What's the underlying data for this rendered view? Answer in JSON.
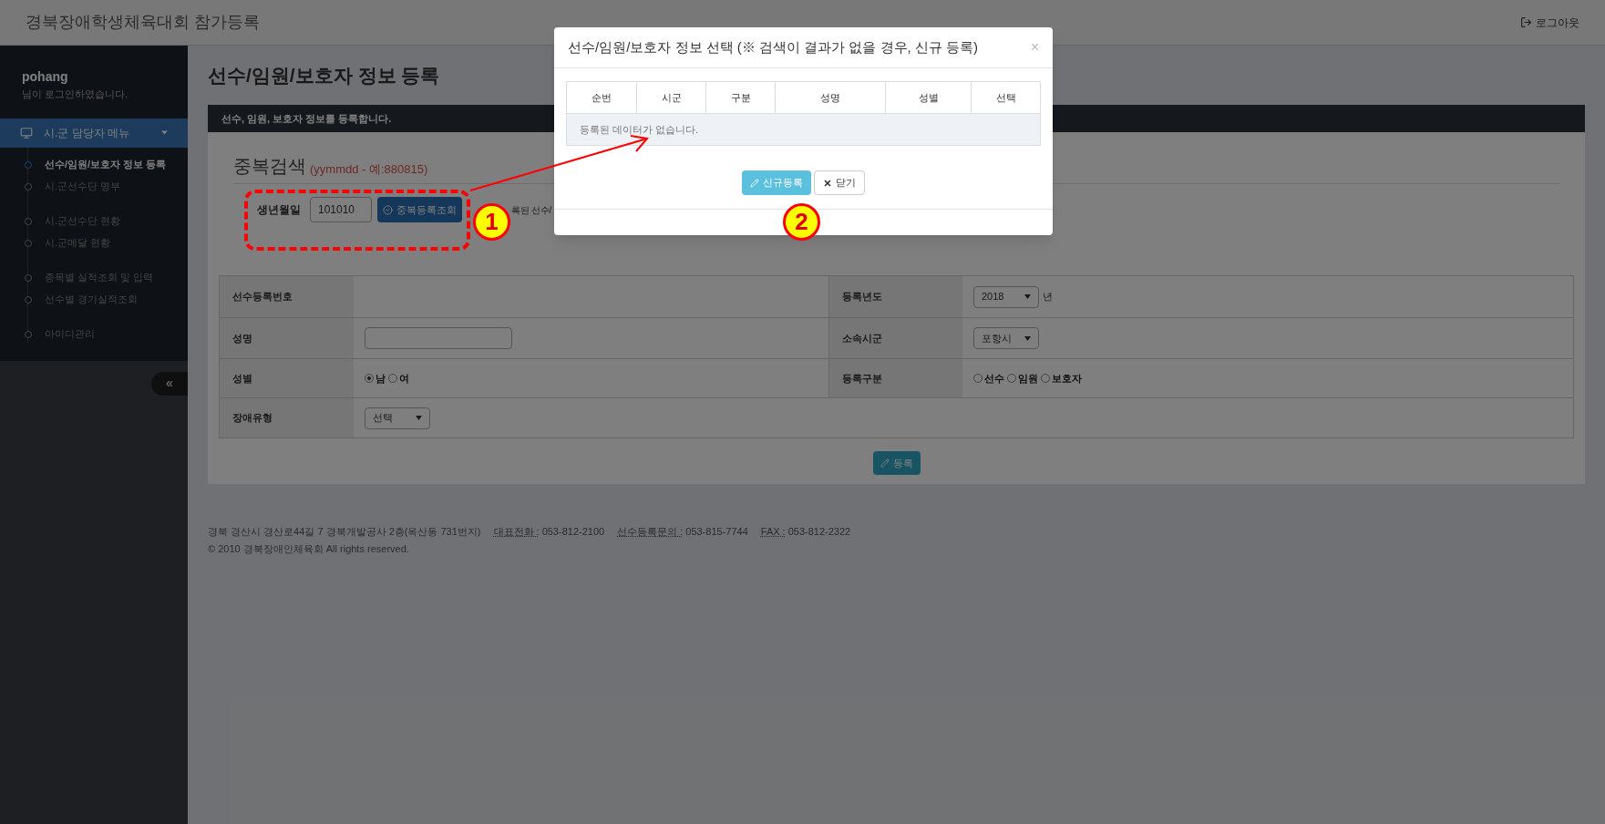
{
  "header": {
    "title": "경북장애학생체육대회 참가등록",
    "logout": "로그아웃"
  },
  "sidebar": {
    "user": "pohang",
    "login_note": "님이 로그인하였습니다.",
    "menu": {
      "label": "시.군 담당자 메뉴",
      "expanded": true
    },
    "groups": [
      [
        {
          "label": "선수/임원/보호자 정보 등록",
          "selected": true
        },
        {
          "label": "시.군선수단 명부",
          "selected": false
        }
      ],
      [
        {
          "label": "시.군선수단 현황",
          "selected": false
        },
        {
          "label": "시.군메달 현황",
          "selected": false
        }
      ],
      [
        {
          "label": "종목별 실적조회 및 입력",
          "selected": false
        },
        {
          "label": "선수별 경기실적조회",
          "selected": false
        }
      ],
      [
        {
          "label": "아이디관리",
          "selected": false
        }
      ]
    ],
    "collapse": "«"
  },
  "page": {
    "title": "선수/임원/보호자 정보 등록",
    "banner": "선수, 임원, 보호자 정보를 등록합니다.",
    "search": {
      "title": "중복검색",
      "hint": "(yymmdd - 예:880815)",
      "label": "생년월일",
      "value": "101010",
      "button": "중복등록조회",
      "note": "록된 선수/"
    },
    "form": [
      {
        "label": "선수등록번호",
        "field": {
          "kind": "empty"
        },
        "label_2": "등록년도",
        "field_2": {
          "kind": "select",
          "value": "2018",
          "suffix": "년"
        }
      },
      {
        "label": "성명",
        "field": {
          "kind": "input"
        },
        "label_2": "소속시군",
        "field_2": {
          "kind": "select",
          "value": "포항시"
        }
      },
      {
        "label": "성별",
        "field": {
          "kind": "radio",
          "options": [
            {
              "label": "남",
              "selected": true
            },
            {
              "label": "여",
              "selected": false
            }
          ]
        },
        "label_2": "등록구분",
        "field_2": {
          "kind": "radio",
          "options": [
            {
              "label": "선수",
              "selected": false
            },
            {
              "label": "임원",
              "selected": false
            },
            {
              "label": "보호자",
              "selected": false
            }
          ]
        }
      },
      {
        "label": "장애유형",
        "field": {
          "kind": "select",
          "value": "선택"
        }
      }
    ],
    "submit": "등록"
  },
  "footer": {
    "address": "경북 경산시 경산로44길 7 경북개발공사 2층(옥산동 731번지)",
    "contacts": [
      {
        "label": "대표전화 :",
        "value": "053-812-2100"
      },
      {
        "label": "선수등록문의 :",
        "value": "053-815-7744"
      },
      {
        "label": "FAX :",
        "value": "053-812-2322"
      }
    ],
    "copyright": "© 2010 경북장애인체육회 All rights reserved."
  },
  "dialog": {
    "title": "선수/임원/보호자 정보 선택 (※ 검색이 결과가 없을 경우, 신규 등록)",
    "close": "×",
    "columns": [
      "순번",
      "시군",
      "구분",
      "성명",
      "성별",
      "선택"
    ],
    "empty_message": "등록된 데이터가 없습니다.",
    "buttons": [
      {
        "label": "신규등록",
        "kind": "primary"
      },
      {
        "label": "닫기",
        "kind": "default"
      }
    ]
  },
  "annotations": [
    {
      "label": "1"
    },
    {
      "label": "2"
    }
  ]
}
